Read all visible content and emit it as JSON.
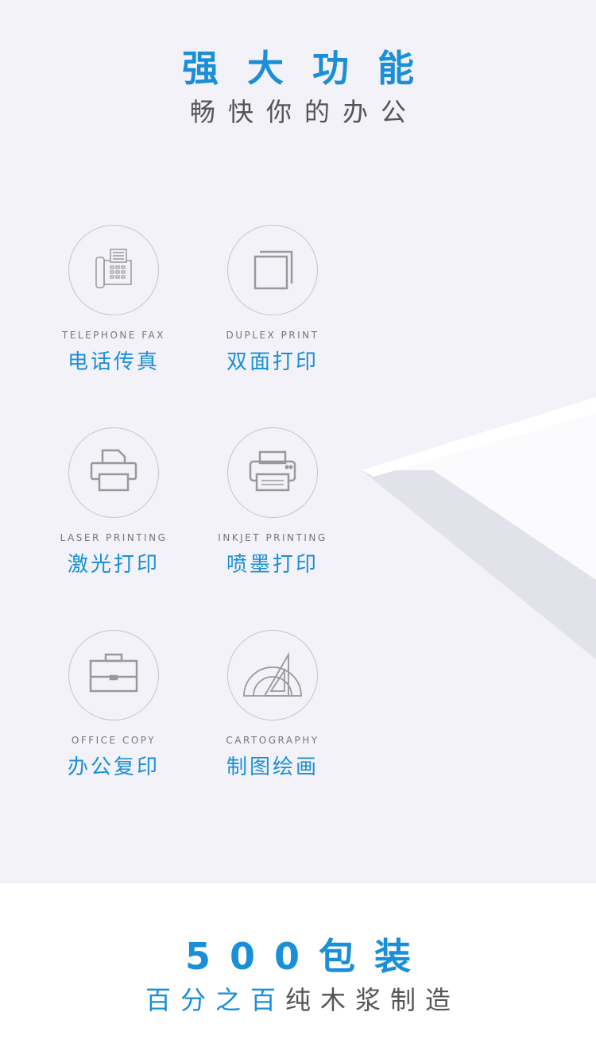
{
  "header": {
    "title": "强大功能",
    "subtitle": "畅快你的办公"
  },
  "features": [
    {
      "en": "TELEPHONE FAX",
      "zh": "电话传真",
      "icon": "fax-icon"
    },
    {
      "en": "DUPLEX PRINT",
      "zh": "双面打印",
      "icon": "duplex-pages-icon"
    },
    {
      "en": "LASER PRINTING",
      "zh": "激光打印",
      "icon": "laser-printer-icon"
    },
    {
      "en": "INKJET PRINTING",
      "zh": "喷墨打印",
      "icon": "inkjet-printer-icon"
    },
    {
      "en": "OFFICE COPY",
      "zh": "办公复印",
      "icon": "briefcase-icon"
    },
    {
      "en": "CARTOGRAPHY",
      "zh": "制图绘画",
      "icon": "protractor-triangle-icon"
    }
  ],
  "footer": {
    "title": "500包装",
    "subtitle_blue": "百分之百",
    "subtitle_gray": "纯木浆制造"
  },
  "colors": {
    "accent": "#1a8fd8",
    "text": "#555555",
    "background": "#f2f2f8"
  }
}
